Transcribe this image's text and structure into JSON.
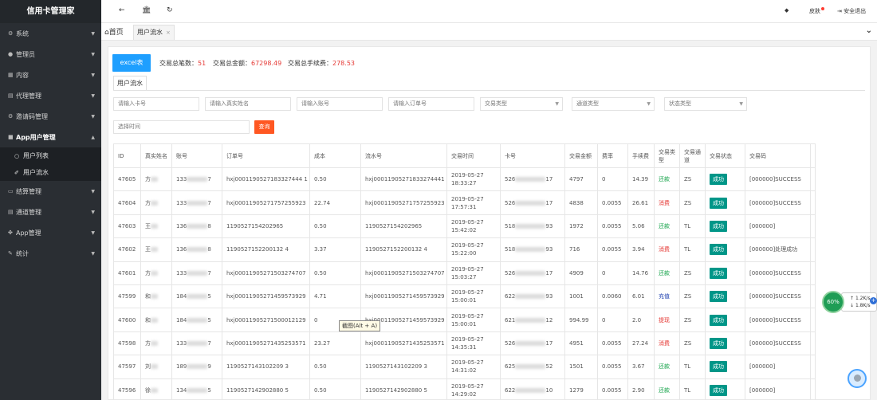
{
  "app": {
    "title": "信用卡管理家"
  },
  "sidebar": {
    "items": [
      {
        "label": "系统",
        "icon": "gear-icon"
      },
      {
        "label": "管理员",
        "icon": "user-icon"
      },
      {
        "label": "内容",
        "icon": "grid-icon"
      },
      {
        "label": "代理管理",
        "icon": "book-icon"
      },
      {
        "label": "邀请码管理",
        "icon": "gear-icon"
      },
      {
        "label": "App用户管理",
        "icon": "lock-icon"
      },
      {
        "label": "结算管理",
        "icon": "monitor-icon"
      },
      {
        "label": "通道管理",
        "icon": "book-icon"
      },
      {
        "label": "App管理",
        "icon": "puzzle-icon"
      },
      {
        "label": "统计",
        "icon": "edit-icon"
      }
    ],
    "sub_items": [
      {
        "label": "用户列表",
        "icon": "user-outline-icon"
      },
      {
        "label": "用户流水",
        "icon": "brush-icon"
      }
    ]
  },
  "topbar": {
    "back": "←",
    "home": "🏛",
    "refresh": "↻",
    "skin_label": "皮肤",
    "logout_label": "安全退出"
  },
  "tabs": {
    "home_label": "首页",
    "active_label": "用户流水",
    "close": "×",
    "dropdown": "⌄"
  },
  "toolbar": {
    "excel_label": "excel表",
    "stat_count_label": "交易总笔数：",
    "stat_count_value": "51",
    "stat_amount_label": "交易总金额：",
    "stat_amount_value": "67298.49",
    "stat_fee_label": "交易总手续费：",
    "stat_fee_value": "278.53",
    "inner_tab_label": "用户流水"
  },
  "filters": {
    "card_placeholder": "请输入卡号",
    "name_placeholder": "请输入真实姓名",
    "account_placeholder": "请输入账号",
    "order_placeholder": "请输入订单号",
    "trade_type_placeholder": "交易类型",
    "channel_type_placeholder": "通道类型",
    "status_type_placeholder": "状态类型",
    "time_placeholder": "选择时间",
    "query_label": "查询"
  },
  "table": {
    "headers": [
      "ID",
      "真实姓名",
      "账号",
      "订单号",
      "成本",
      "流水号",
      "交易时间",
      "卡号",
      "交易金额",
      "费率",
      "手续费",
      "交易类型",
      "交易通道",
      "交易状态",
      "交易码",
      "操作"
    ],
    "rows": [
      {
        "id": "47605",
        "name": "方",
        "account_pre": "133",
        "account_suf": "7",
        "order": "hxj0001190527183327444 1",
        "cost": "0.50",
        "serial": "hxj00011905271833274441",
        "date": "2019-05-27",
        "time": "18:33:27",
        "card_pre": "526",
        "card_suf": "17",
        "amount": "4797",
        "rate": "0",
        "fee": "14.39",
        "type": "还款",
        "type_class": "tt-repay",
        "channel": "ZS",
        "status": "成功",
        "code": "[000000]SUCCESS"
      },
      {
        "id": "47604",
        "name": "方",
        "account_pre": "133",
        "account_suf": "7",
        "order": "hxj00011905271757255923",
        "cost": "22.74",
        "serial": "hxj00011905271757255923",
        "date": "2019-05-27",
        "time": "17:57:31",
        "card_pre": "526",
        "card_suf": "17",
        "amount": "4838",
        "rate": "0.0055",
        "fee": "26.61",
        "type": "消费",
        "type_class": "tt-consume",
        "channel": "ZS",
        "status": "成功",
        "code": "[000000]SUCCESS"
      },
      {
        "id": "47603",
        "name": "王",
        "account_pre": "136",
        "account_suf": "8",
        "order": "1190527154202965",
        "cost": "0.50",
        "serial": "1190527154202965",
        "date": "2019-05-27",
        "time": "15:42:02",
        "card_pre": "518",
        "card_suf": "93",
        "amount": "1972",
        "rate": "0.0055",
        "fee": "5.06",
        "type": "还款",
        "type_class": "tt-repay",
        "channel": "TL",
        "status": "成功",
        "code": "[000000]"
      },
      {
        "id": "47602",
        "name": "王",
        "account_pre": "136",
        "account_suf": "8",
        "order": "1190527152200132 4",
        "cost": "3.37",
        "serial": "1190527152200132 4",
        "date": "2019-05-27",
        "time": "15:22:00",
        "card_pre": "518",
        "card_suf": "93",
        "amount": "716",
        "rate": "0.0055",
        "fee": "3.94",
        "type": "消费",
        "type_class": "tt-consume",
        "channel": "TL",
        "status": "成功",
        "code": "[000000]处理成功"
      },
      {
        "id": "47601",
        "name": "方",
        "account_pre": "133",
        "account_suf": "7",
        "order": "hxj00011905271503274707",
        "cost": "0.50",
        "serial": "hxj00011905271503274707",
        "date": "2019-05-27",
        "time": "15:03:27",
        "card_pre": "526",
        "card_suf": "17",
        "amount": "4909",
        "rate": "0",
        "fee": "14.76",
        "type": "还款",
        "type_class": "tt-repay",
        "channel": "ZS",
        "status": "成功",
        "code": "[000000]SUCCESS"
      },
      {
        "id": "47599",
        "name": "和",
        "account_pre": "184",
        "account_suf": "5",
        "order": "hxj00011905271459573929",
        "cost": "4.71",
        "serial": "hxj00011905271459573929",
        "date": "2019-05-27",
        "time": "15:00:01",
        "card_pre": "622",
        "card_suf": "93",
        "amount": "1001",
        "rate": "0.0060",
        "fee": "6.01",
        "type": "充值",
        "type_class": "tt-recharge",
        "channel": "ZS",
        "status": "成功",
        "code": "[000000]SUCCESS"
      },
      {
        "id": "47600",
        "name": "和",
        "account_pre": "184",
        "account_suf": "5",
        "order": "hxj00011905271500012129",
        "cost": "0",
        "serial": "hxj00011905271459573929",
        "date": "2019-05-27",
        "time": "15:00:01",
        "card_pre": "621",
        "card_suf": "12",
        "amount": "994.99",
        "rate": "0",
        "fee": "2.0",
        "type": "提现",
        "type_class": "tt-withdraw",
        "channel": "ZS",
        "status": "成功",
        "code": "[000000]SUCCESS"
      },
      {
        "id": "47598",
        "name": "方",
        "account_pre": "133",
        "account_suf": "7",
        "order": "hxj00011905271435253571",
        "cost": "23.27",
        "serial": "hxj00011905271435253571",
        "date": "2019-05-27",
        "time": "14:35:31",
        "card_pre": "526",
        "card_suf": "17",
        "amount": "4951",
        "rate": "0.0055",
        "fee": "27.24",
        "type": "消费",
        "type_class": "tt-consume",
        "channel": "ZS",
        "status": "成功",
        "code": "[000000]SUCCESS"
      },
      {
        "id": "47597",
        "name": "刘",
        "account_pre": "189",
        "account_suf": "9",
        "order": "1190527143102209 3",
        "cost": "0.50",
        "serial": "1190527143102209 3",
        "date": "2019-05-27",
        "time": "14:31:02",
        "card_pre": "625",
        "card_suf": "52",
        "amount": "1501",
        "rate": "0.0055",
        "fee": "3.67",
        "type": "还款",
        "type_class": "tt-repay",
        "channel": "TL",
        "status": "成功",
        "code": "[000000]"
      },
      {
        "id": "47596",
        "name": "徐",
        "account_pre": "134",
        "account_suf": "5",
        "order": "1190527142902880 5",
        "cost": "0.50",
        "serial": "1190527142902880 5",
        "date": "2019-05-27",
        "time": "14:29:02",
        "card_pre": "622",
        "card_suf": "10",
        "amount": "1279",
        "rate": "0.0055",
        "fee": "2.90",
        "type": "还款",
        "type_class": "tt-repay",
        "channel": "TL",
        "status": "成功",
        "code": "[000000]"
      }
    ]
  },
  "overlay": {
    "tooltip": "截图(Alt + A)",
    "speed_percent": "60%",
    "speed_up": "1.2K/s",
    "speed_down": "1.8K/s",
    "speed_plus": "+"
  }
}
